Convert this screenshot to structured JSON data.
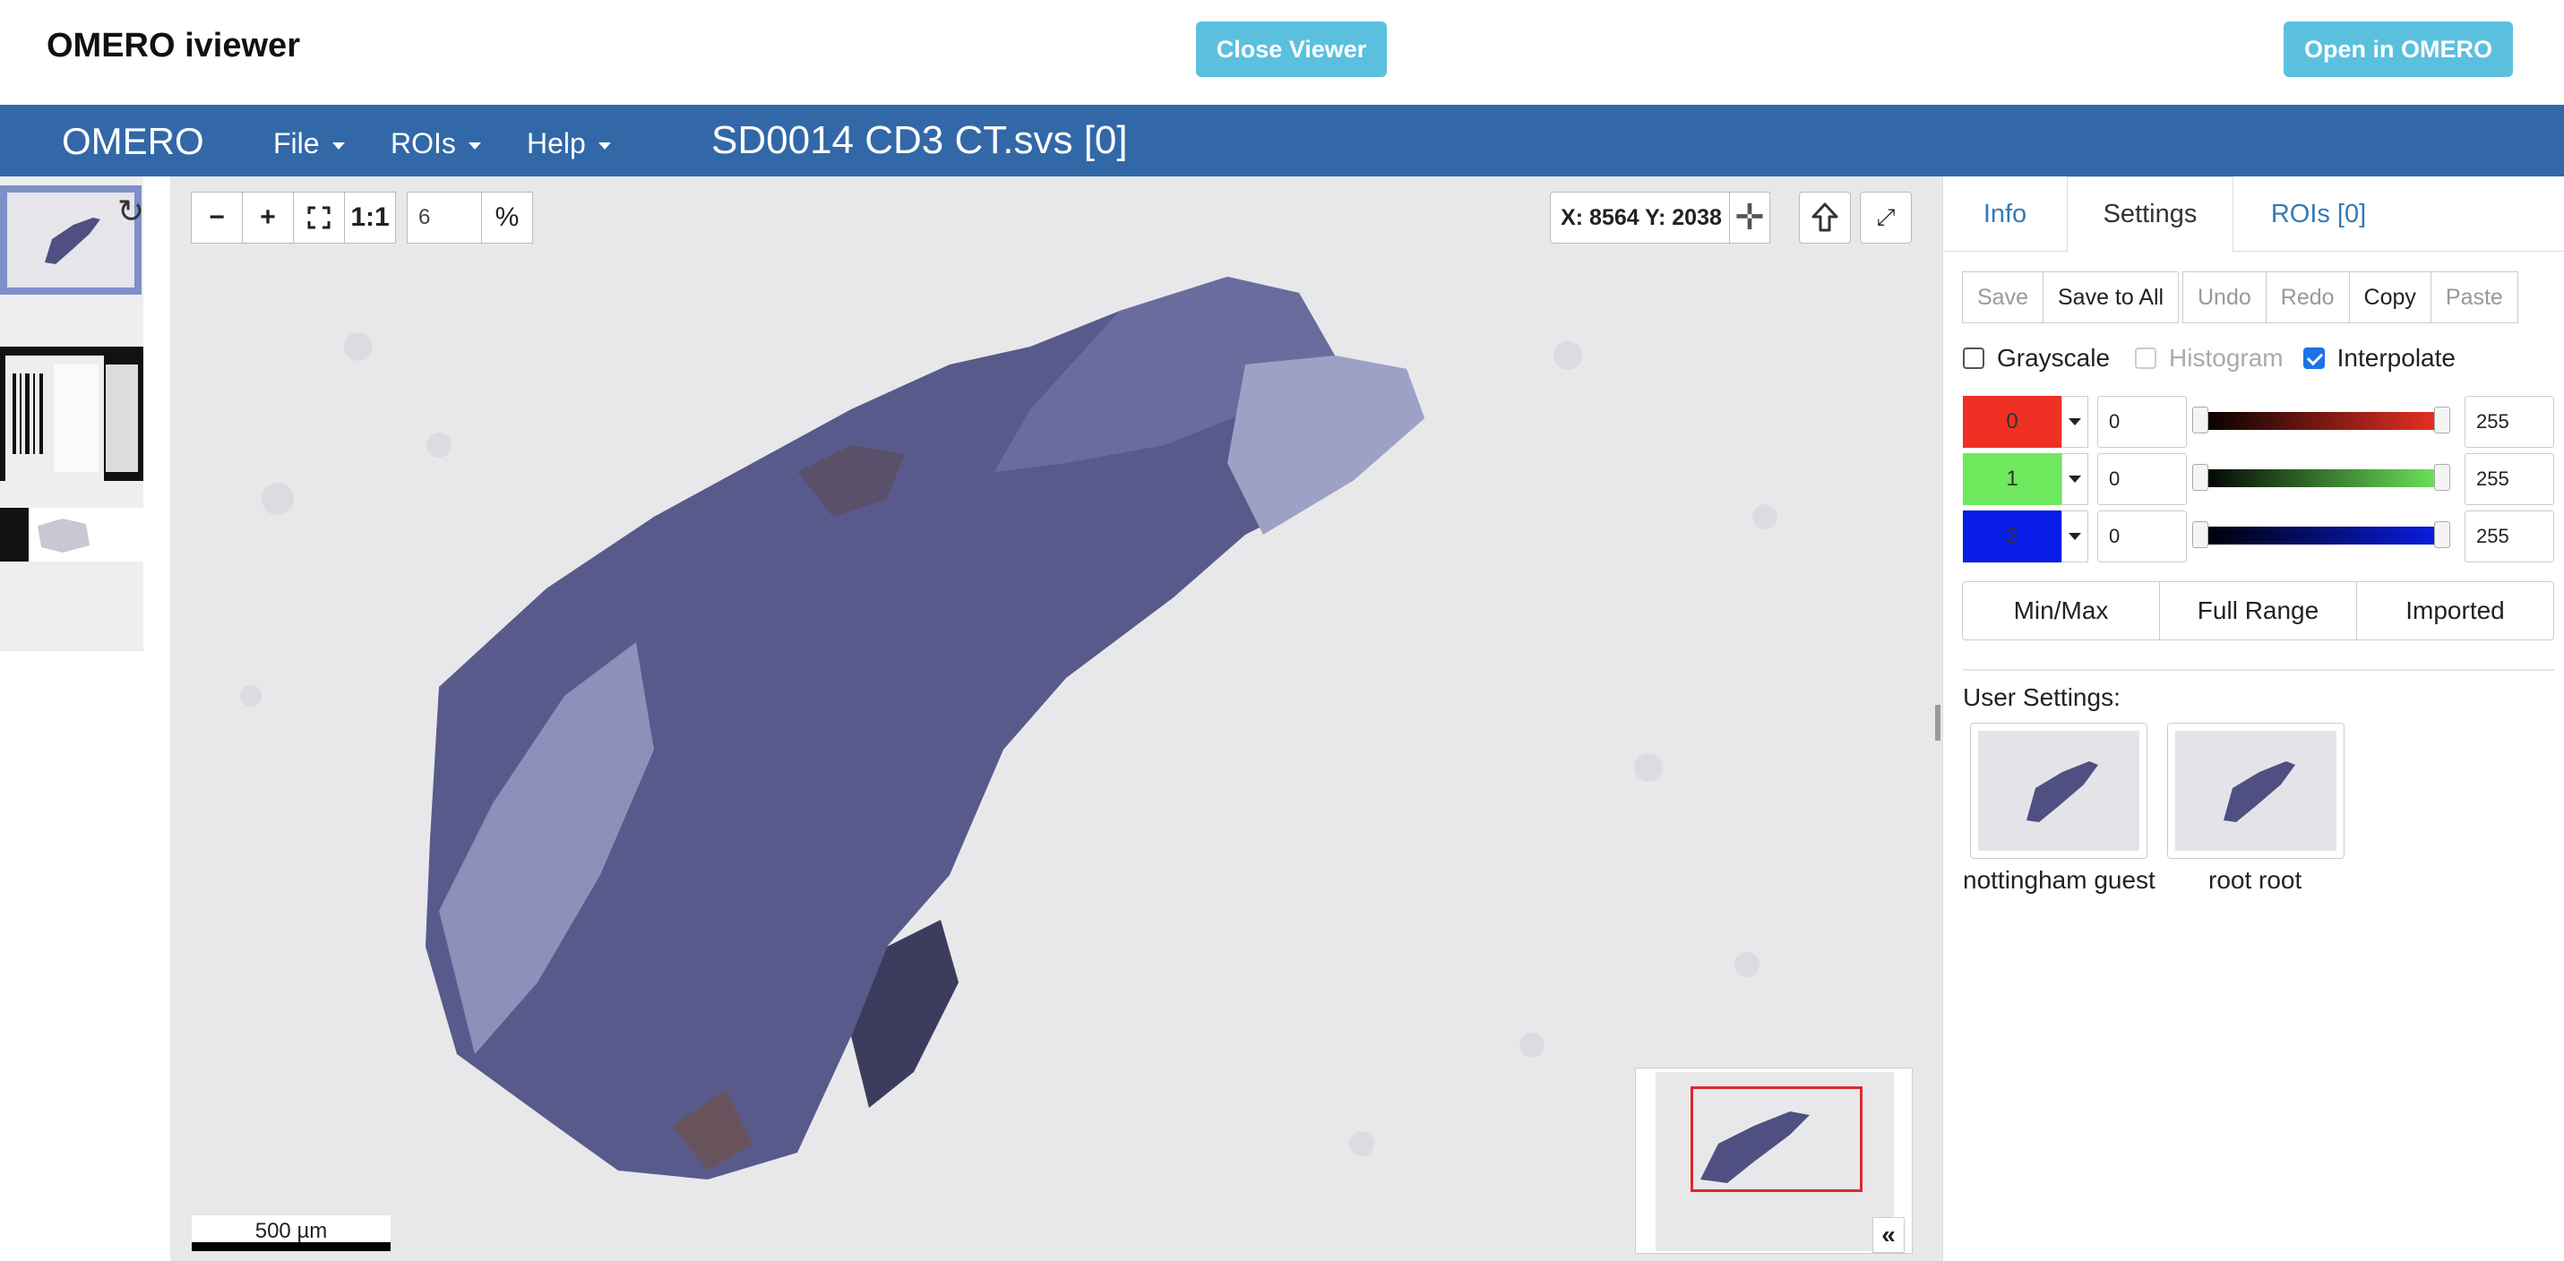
{
  "app": {
    "title": "OMERO iviewer",
    "close_label": "Close Viewer",
    "open_label": "Open in OMERO"
  },
  "navbar": {
    "brand": "OMERO",
    "menus": [
      {
        "label": "File"
      },
      {
        "label": "ROIs"
      },
      {
        "label": "Help"
      }
    ],
    "image_title": "SD0014 CD3 CT.svs [0]"
  },
  "toolbar": {
    "zoom_out": "−",
    "zoom_in": "+",
    "actual_size": "1:1",
    "zoom_value": "6",
    "zoom_unit": "%"
  },
  "viewer": {
    "coords": "X: 8564 Y: 2038",
    "scalebar": "500 µm",
    "overview_toggle": "«"
  },
  "panel": {
    "tabs": [
      {
        "label": "Info"
      },
      {
        "label": "Settings"
      },
      {
        "label": "ROIs [0]"
      }
    ],
    "buttons": {
      "save": "Save",
      "save_all": "Save to All",
      "undo": "Undo",
      "redo": "Redo",
      "copy": "Copy",
      "paste": "Paste"
    },
    "options": {
      "grayscale": "Grayscale",
      "histogram": "Histogram",
      "interpolate": "Interpolate",
      "interpolate_checked": true
    },
    "channels": [
      {
        "label": "0",
        "color": "#ee3124",
        "min": "0",
        "max": "255"
      },
      {
        "label": "1",
        "color": "#6ee85c",
        "min": "0",
        "max": "255"
      },
      {
        "label": "2",
        "color": "#0a1de8",
        "min": "0",
        "max": "255"
      }
    ],
    "range_buttons": {
      "minmax": "Min/Max",
      "full": "Full Range",
      "imported": "Imported"
    },
    "user_settings_label": "User Settings:",
    "users": [
      {
        "name": "nottingham guest"
      },
      {
        "name": "root root"
      }
    ]
  }
}
